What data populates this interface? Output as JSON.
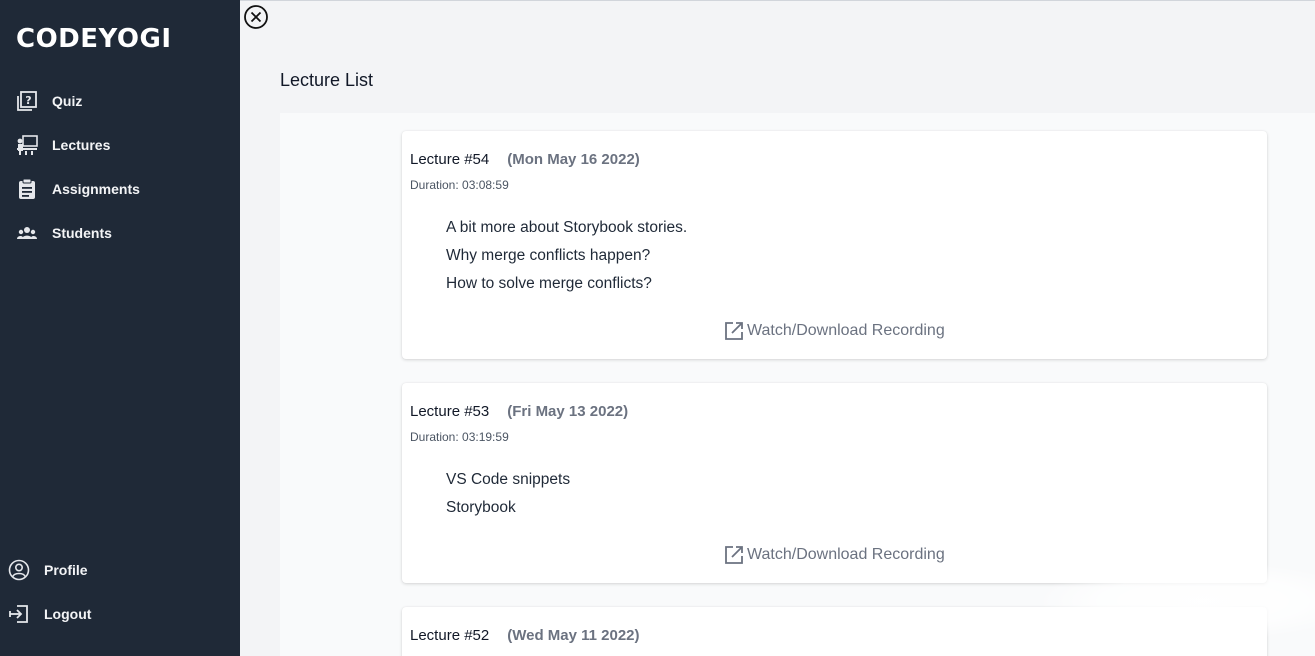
{
  "brand": "CODEYOGI",
  "nav": {
    "items": [
      {
        "label": "Quiz",
        "icon": "quiz-icon"
      },
      {
        "label": "Lectures",
        "icon": "lectures-icon"
      },
      {
        "label": "Assignments",
        "icon": "assignments-icon"
      },
      {
        "label": "Students",
        "icon": "students-icon"
      }
    ],
    "bottom": [
      {
        "label": "Profile",
        "icon": "profile-icon"
      },
      {
        "label": "Logout",
        "icon": "logout-icon"
      }
    ]
  },
  "page_title": "Lecture List",
  "lectures": [
    {
      "number": "Lecture #54",
      "date": "(Mon May 16 2022)",
      "duration": "Duration: 03:08:59",
      "topics": [
        "A bit more about Storybook stories.",
        "Why merge conflicts happen?",
        "How to solve merge conflicts?"
      ],
      "link": "Watch/Download Recording"
    },
    {
      "number": "Lecture #53",
      "date": "(Fri May 13 2022)",
      "duration": "Duration: 03:19:59",
      "topics": [
        "VS Code snippets",
        "Storybook"
      ],
      "link": "Watch/Download Recording"
    },
    {
      "number": "Lecture #52",
      "date": "(Wed May 11 2022)"
    }
  ],
  "colors": {
    "sidebar": "#1f2937",
    "background": "#f3f4f6",
    "card": "#ffffff",
    "muted": "#6b7280"
  }
}
